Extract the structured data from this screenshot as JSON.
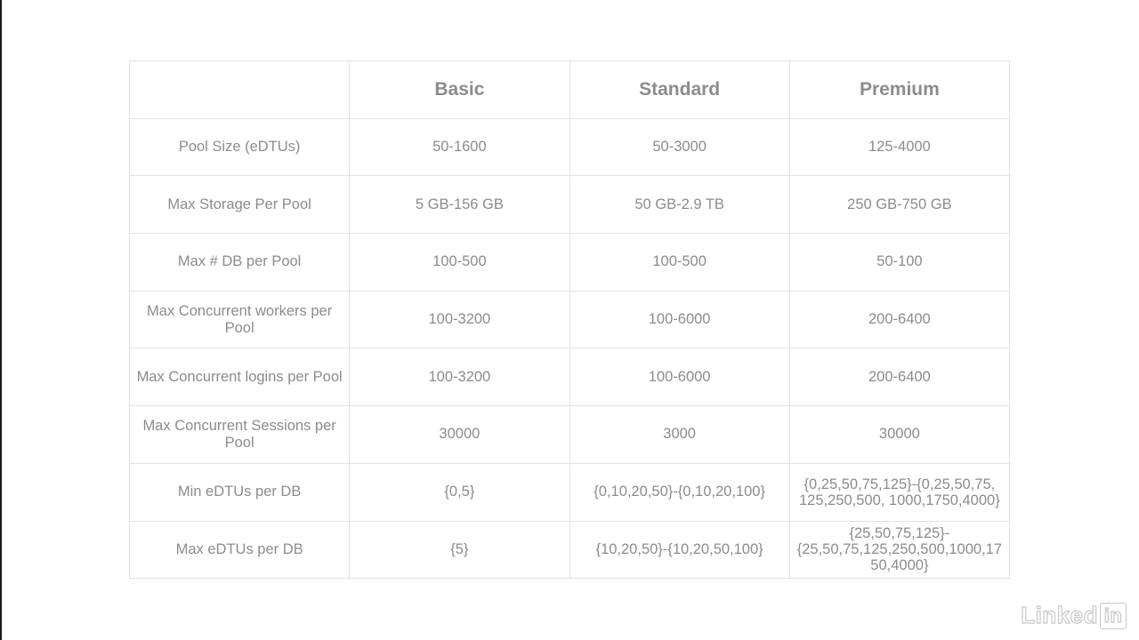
{
  "table": {
    "headers": [
      "",
      "Basic",
      "Standard",
      "Premium"
    ],
    "rows": [
      [
        "Pool Size (eDTUs)",
        "50-1600",
        "50-3000",
        "125-4000"
      ],
      [
        "Max Storage Per Pool",
        "5 GB-156 GB",
        "50 GB-2.9 TB",
        "250 GB-750 GB"
      ],
      [
        "Max # DB per Pool",
        "100-500",
        "100-500",
        "50-100"
      ],
      [
        "Max Concurrent workers per Pool",
        "100-3200",
        "100-6000",
        "200-6400"
      ],
      [
        "Max Concurrent logins per Pool",
        "100-3200",
        "100-6000",
        "200-6400"
      ],
      [
        "Max Concurrent Sessions per Pool",
        "30000",
        "3000",
        "30000"
      ],
      [
        "Min eDTUs per DB",
        "{0,5}",
        "{0,10,20,50}-{0,10,20,100}",
        "{0,25,50,75,125}-{0,25,50,75, 125,250,500, 1000,1750,4000}"
      ],
      [
        "Max eDTUs per DB",
        "{5}",
        "{10,20,50}-{10,20,50,100}",
        "{25,50,75,125}- {25,50,75,125,250,500,1000,17 50,4000}"
      ]
    ]
  },
  "watermark": {
    "text": "Linked",
    "box_text": "in"
  }
}
